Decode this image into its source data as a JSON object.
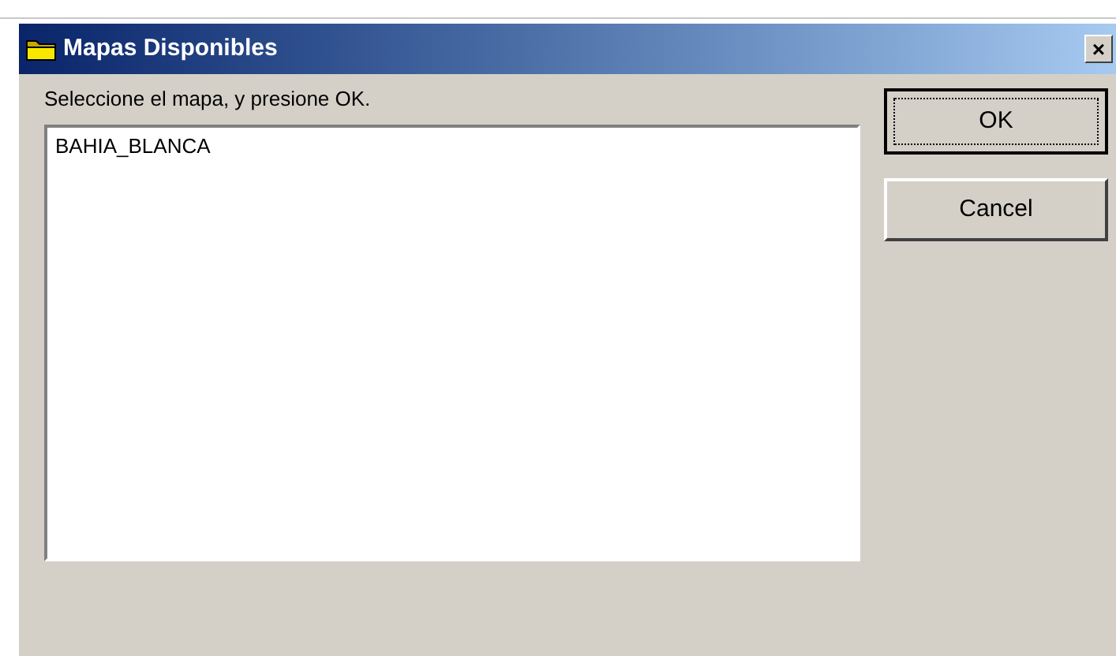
{
  "window": {
    "title": "Mapas Disponibles",
    "close": "×"
  },
  "prompt": "Seleccione el mapa, y presione OK.",
  "maps": [
    {
      "name": "BAHIA_BLANCA",
      "selected": false
    }
  ],
  "buttons": [
    {
      "label": "OK",
      "default": true
    },
    {
      "label": "Cancel",
      "default": false
    }
  ]
}
